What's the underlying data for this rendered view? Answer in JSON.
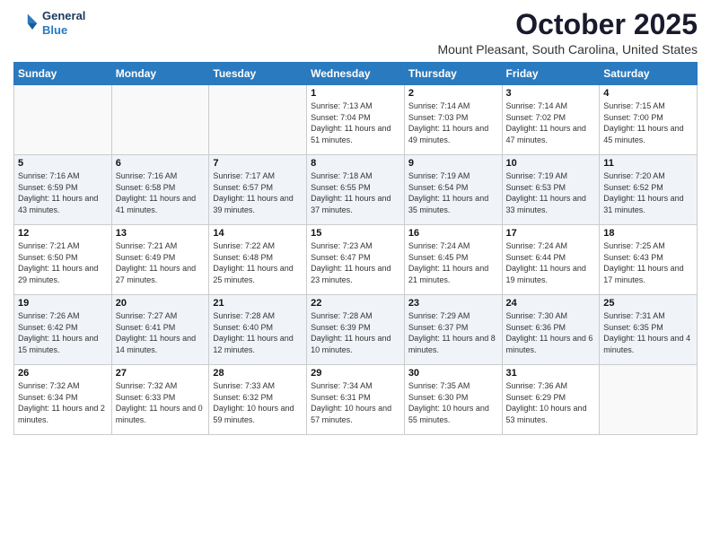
{
  "logo": {
    "line1": "General",
    "line2": "Blue"
  },
  "title": "October 2025",
  "location": "Mount Pleasant, South Carolina, United States",
  "days_of_week": [
    "Sunday",
    "Monday",
    "Tuesday",
    "Wednesday",
    "Thursday",
    "Friday",
    "Saturday"
  ],
  "weeks": [
    [
      {
        "day": "",
        "sunrise": "",
        "sunset": "",
        "daylight": ""
      },
      {
        "day": "",
        "sunrise": "",
        "sunset": "",
        "daylight": ""
      },
      {
        "day": "",
        "sunrise": "",
        "sunset": "",
        "daylight": ""
      },
      {
        "day": "1",
        "sunrise": "Sunrise: 7:13 AM",
        "sunset": "Sunset: 7:04 PM",
        "daylight": "Daylight: 11 hours and 51 minutes."
      },
      {
        "day": "2",
        "sunrise": "Sunrise: 7:14 AM",
        "sunset": "Sunset: 7:03 PM",
        "daylight": "Daylight: 11 hours and 49 minutes."
      },
      {
        "day": "3",
        "sunrise": "Sunrise: 7:14 AM",
        "sunset": "Sunset: 7:02 PM",
        "daylight": "Daylight: 11 hours and 47 minutes."
      },
      {
        "day": "4",
        "sunrise": "Sunrise: 7:15 AM",
        "sunset": "Sunset: 7:00 PM",
        "daylight": "Daylight: 11 hours and 45 minutes."
      }
    ],
    [
      {
        "day": "5",
        "sunrise": "Sunrise: 7:16 AM",
        "sunset": "Sunset: 6:59 PM",
        "daylight": "Daylight: 11 hours and 43 minutes."
      },
      {
        "day": "6",
        "sunrise": "Sunrise: 7:16 AM",
        "sunset": "Sunset: 6:58 PM",
        "daylight": "Daylight: 11 hours and 41 minutes."
      },
      {
        "day": "7",
        "sunrise": "Sunrise: 7:17 AM",
        "sunset": "Sunset: 6:57 PM",
        "daylight": "Daylight: 11 hours and 39 minutes."
      },
      {
        "day": "8",
        "sunrise": "Sunrise: 7:18 AM",
        "sunset": "Sunset: 6:55 PM",
        "daylight": "Daylight: 11 hours and 37 minutes."
      },
      {
        "day": "9",
        "sunrise": "Sunrise: 7:19 AM",
        "sunset": "Sunset: 6:54 PM",
        "daylight": "Daylight: 11 hours and 35 minutes."
      },
      {
        "day": "10",
        "sunrise": "Sunrise: 7:19 AM",
        "sunset": "Sunset: 6:53 PM",
        "daylight": "Daylight: 11 hours and 33 minutes."
      },
      {
        "day": "11",
        "sunrise": "Sunrise: 7:20 AM",
        "sunset": "Sunset: 6:52 PM",
        "daylight": "Daylight: 11 hours and 31 minutes."
      }
    ],
    [
      {
        "day": "12",
        "sunrise": "Sunrise: 7:21 AM",
        "sunset": "Sunset: 6:50 PM",
        "daylight": "Daylight: 11 hours and 29 minutes."
      },
      {
        "day": "13",
        "sunrise": "Sunrise: 7:21 AM",
        "sunset": "Sunset: 6:49 PM",
        "daylight": "Daylight: 11 hours and 27 minutes."
      },
      {
        "day": "14",
        "sunrise": "Sunrise: 7:22 AM",
        "sunset": "Sunset: 6:48 PM",
        "daylight": "Daylight: 11 hours and 25 minutes."
      },
      {
        "day": "15",
        "sunrise": "Sunrise: 7:23 AM",
        "sunset": "Sunset: 6:47 PM",
        "daylight": "Daylight: 11 hours and 23 minutes."
      },
      {
        "day": "16",
        "sunrise": "Sunrise: 7:24 AM",
        "sunset": "Sunset: 6:45 PM",
        "daylight": "Daylight: 11 hours and 21 minutes."
      },
      {
        "day": "17",
        "sunrise": "Sunrise: 7:24 AM",
        "sunset": "Sunset: 6:44 PM",
        "daylight": "Daylight: 11 hours and 19 minutes."
      },
      {
        "day": "18",
        "sunrise": "Sunrise: 7:25 AM",
        "sunset": "Sunset: 6:43 PM",
        "daylight": "Daylight: 11 hours and 17 minutes."
      }
    ],
    [
      {
        "day": "19",
        "sunrise": "Sunrise: 7:26 AM",
        "sunset": "Sunset: 6:42 PM",
        "daylight": "Daylight: 11 hours and 15 minutes."
      },
      {
        "day": "20",
        "sunrise": "Sunrise: 7:27 AM",
        "sunset": "Sunset: 6:41 PM",
        "daylight": "Daylight: 11 hours and 14 minutes."
      },
      {
        "day": "21",
        "sunrise": "Sunrise: 7:28 AM",
        "sunset": "Sunset: 6:40 PM",
        "daylight": "Daylight: 11 hours and 12 minutes."
      },
      {
        "day": "22",
        "sunrise": "Sunrise: 7:28 AM",
        "sunset": "Sunset: 6:39 PM",
        "daylight": "Daylight: 11 hours and 10 minutes."
      },
      {
        "day": "23",
        "sunrise": "Sunrise: 7:29 AM",
        "sunset": "Sunset: 6:37 PM",
        "daylight": "Daylight: 11 hours and 8 minutes."
      },
      {
        "day": "24",
        "sunrise": "Sunrise: 7:30 AM",
        "sunset": "Sunset: 6:36 PM",
        "daylight": "Daylight: 11 hours and 6 minutes."
      },
      {
        "day": "25",
        "sunrise": "Sunrise: 7:31 AM",
        "sunset": "Sunset: 6:35 PM",
        "daylight": "Daylight: 11 hours and 4 minutes."
      }
    ],
    [
      {
        "day": "26",
        "sunrise": "Sunrise: 7:32 AM",
        "sunset": "Sunset: 6:34 PM",
        "daylight": "Daylight: 11 hours and 2 minutes."
      },
      {
        "day": "27",
        "sunrise": "Sunrise: 7:32 AM",
        "sunset": "Sunset: 6:33 PM",
        "daylight": "Daylight: 11 hours and 0 minutes."
      },
      {
        "day": "28",
        "sunrise": "Sunrise: 7:33 AM",
        "sunset": "Sunset: 6:32 PM",
        "daylight": "Daylight: 10 hours and 59 minutes."
      },
      {
        "day": "29",
        "sunrise": "Sunrise: 7:34 AM",
        "sunset": "Sunset: 6:31 PM",
        "daylight": "Daylight: 10 hours and 57 minutes."
      },
      {
        "day": "30",
        "sunrise": "Sunrise: 7:35 AM",
        "sunset": "Sunset: 6:30 PM",
        "daylight": "Daylight: 10 hours and 55 minutes."
      },
      {
        "day": "31",
        "sunrise": "Sunrise: 7:36 AM",
        "sunset": "Sunset: 6:29 PM",
        "daylight": "Daylight: 10 hours and 53 minutes."
      },
      {
        "day": "",
        "sunrise": "",
        "sunset": "",
        "daylight": ""
      }
    ]
  ]
}
